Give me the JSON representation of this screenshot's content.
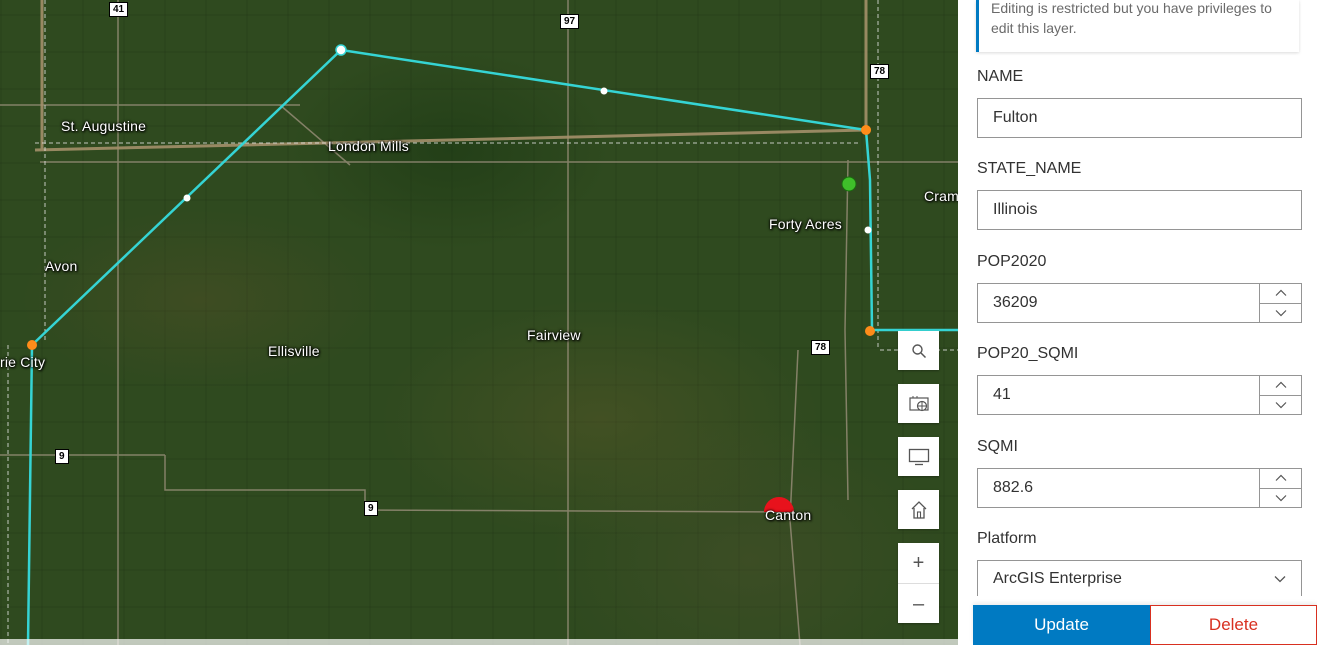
{
  "map": {
    "places": [
      "St. Augustine",
      "London Mills",
      "Avon",
      "Forty Acres",
      "Cram",
      "Fairview",
      "Ellisville",
      "rie City",
      "Canton"
    ],
    "highways": [
      "41",
      "97",
      "78",
      "78",
      "9",
      "9"
    ],
    "controls": {
      "search_icon": "search-icon",
      "basemap_icon": "basemap-gallery-icon",
      "screen_icon": "monitor-icon",
      "home_icon": "home-icon",
      "zoom_in": "+",
      "zoom_out": "–"
    },
    "colors": {
      "boundary": "#35d4d4",
      "vertex": "#ff8c1a",
      "point_green": "#3fbf2a",
      "point_red": "#e8121c"
    }
  },
  "panel": {
    "notice": "Editing is restricted but you have privileges to edit this layer.",
    "fields": [
      {
        "label": "NAME",
        "value": "Fulton"
      },
      {
        "label": "STATE_NAME",
        "value": "Illinois"
      },
      {
        "label": "POP2020",
        "value": "36209"
      },
      {
        "label": "POP20_SQMI",
        "value": "41"
      },
      {
        "label": "SQMI",
        "value": "882.6"
      }
    ],
    "platform_label": "Platform",
    "platform_value": "ArcGIS Enterprise",
    "update_label": "Update",
    "delete_label": "Delete",
    "accent": "#007ac2",
    "danger": "#d83020"
  }
}
